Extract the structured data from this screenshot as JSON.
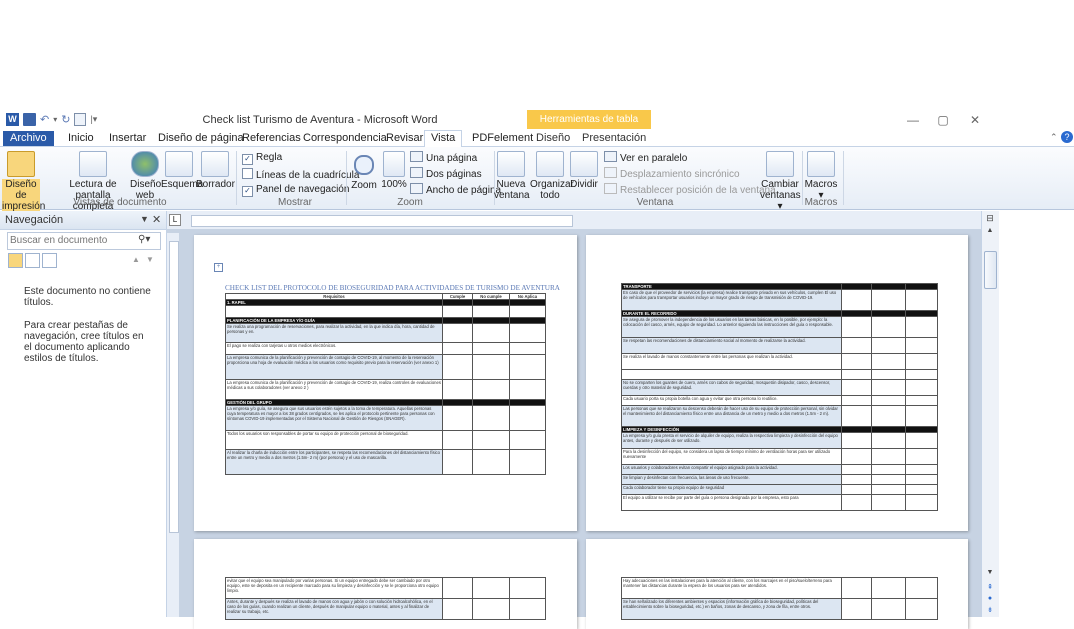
{
  "window": {
    "title": "Check list Turismo de Aventura - Microsoft Word",
    "context_tab_header": "Herramientas de tabla"
  },
  "tabs": [
    "Archivo",
    "Inicio",
    "Insertar",
    "Diseño de página",
    "Referencias",
    "Correspondencia",
    "Revisar",
    "Vista",
    "PDFelement",
    "Diseño",
    "Presentación"
  ],
  "active_tab": "Vista",
  "ribbon": {
    "doc_views": {
      "group": "Vistas de documento",
      "print_layout": [
        "Diseño de",
        "impresión"
      ],
      "full_screen": [
        "Lectura de",
        "pantalla completa"
      ],
      "web": [
        "Diseño",
        "web"
      ],
      "outline": "Esquema",
      "draft": "Borrador"
    },
    "show": {
      "group": "Mostrar",
      "ruler": "Regla",
      "gridlines": "Líneas de la cuadrícula",
      "nav_pane": "Panel de navegación"
    },
    "zoom": {
      "group": "Zoom",
      "zoom": "Zoom",
      "hundred": "100%",
      "one_page": "Una página",
      "two_pages": "Dos páginas",
      "page_width": "Ancho de página"
    },
    "window": {
      "group": "Ventana",
      "new_window": [
        "Nueva",
        "ventana"
      ],
      "arrange_all": [
        "Organizar",
        "todo"
      ],
      "split": "Dividir",
      "side_by_side": "Ver en paralelo",
      "sync_scroll": "Desplazamiento sincrónico",
      "reset_position": "Restablecer posición de la ventana",
      "switch_windows": [
        "Cambiar",
        "ventanas ▾"
      ]
    },
    "macros": {
      "group": "Macros",
      "macros": "Macros"
    }
  },
  "nav_pane": {
    "title": "Navegación",
    "search_placeholder": "Buscar en documento",
    "empty_line1": "Este documento no contiene títulos.",
    "empty_line2": "Para crear pestañas de navegación, cree títulos en el documento aplicando estilos de títulos."
  },
  "document": {
    "page1": {
      "title": "CHECK LIST DEL PROTOCOLO DE BIOSEGURIDAD PARA ACTIVIDADES DE TURISMO DE AVENTURA",
      "headers": [
        "Requisitos",
        "Cumple",
        "No cumple",
        "No Aplica"
      ],
      "rows": [
        {
          "type": "sec",
          "text": "1.   RAPEL"
        },
        {
          "type": "blank",
          "text": ""
        },
        {
          "type": "sec",
          "text": "PLANIFICACIÓN DE LA EMPRESA Y/O GUÍA"
        },
        {
          "type": "blue",
          "text": "Se realiza una programación de reservaciones, para realizar la actividad, en la que indica día, hora, cantidad de personas y en."
        },
        {
          "type": "row",
          "text": "El pago se realiza con tarjetas u otros medios electrónicos."
        },
        {
          "type": "blue",
          "text": "La empresa comunica de la planificación y prevención de contagio de COVID-19, al momento de la reservación proporciona una hoja de evaluación médica a los usuarios como requisito previo para la reservación (ver anexo 1)"
        },
        {
          "type": "row",
          "text": "La empresa comunica de la planificación y prevención de contagio de COVID-19, realiza controles de evaluaciones médicas a sus colaboradores (ver anexo 2 )"
        },
        {
          "type": "sec",
          "text": "GESTIÓN DEL GRUPO"
        },
        {
          "type": "blue",
          "text": "La empresa y/o guía, se asegura que sus usuarios estén sujetos a la toma de temperatura. Aquellas personas cuya temperatura es mayor a los 38 grados centígrados, se les aplica el protocolo pertinente para personas con síntomas COVID-19 implementadas por el Sistema Nacional de Gestión de Riesgos (SNAGER)."
        },
        {
          "type": "row",
          "text": "Todos los usuarios son responsables de portar su equipo de protección personal de bioseguridad."
        },
        {
          "type": "blue",
          "text": "Al realizar la charla de inducción entre los participantes, se respeta las recomendaciones del distanciamiento físico entre un metro y medio a dos metros (1.5m- 2 m) (por persona) y el uso de mascarilla."
        }
      ]
    },
    "page2": {
      "rows": [
        {
          "type": "sec",
          "text": "TRANSPORTE"
        },
        {
          "type": "blue",
          "text": "En caso de que el proveedor de servicios (la empresa) realice transporte privado en sus vehículos, cumplen El uso de vehículos para transportar usuarios incluye un mayor grado de riesgo de transmisión de COVID-19."
        },
        {
          "type": "sec",
          "text": "DURANTE EL RECORRIDO"
        },
        {
          "type": "blue",
          "text": "Se asegura de promover la independencia de los usuarios en las tareas básicas, en lo posible, por ejemplo: la colocación del casco, arnés, equipo de seguridad. Lo anterior siguiendo las instrucciones del guía o responsable."
        },
        {
          "type": "blue",
          "text": "Se respetan las recomendaciones de distanciamiento social al momento de realizarse la actividad."
        },
        {
          "type": "row",
          "text": "Se realiza el lavado de manos constantemente entre las personas que realizan la actividad."
        },
        {
          "type": "row",
          "text": ""
        },
        {
          "type": "blue",
          "text": "No se comparten los guantes de cuero, arnés con cabos de seguridad, mosquetón disipador, casco, descensor, cuerdas y otro material de seguridad."
        },
        {
          "type": "row",
          "text": "Cada usuario porta su propia botella con agua y evitar que otra persona lo reutilice."
        },
        {
          "type": "blue",
          "text": "Las personas que se realizaron su descenso deberán de hacer uso de su equipo de protección personal, sin olvidar el mantenimiento del distanciamiento físico entre una distancia de un metro y medio a dos metros (1.5m - 2 m)."
        },
        {
          "type": "sec",
          "text": "LIMPIEZA Y DESINFECCIÓN"
        },
        {
          "type": "blue",
          "text": "La empresa y/o guía presta el servicio de alquiler de equipo, realiza la respectiva limpieza y desinfección del equipo antes, durante y después de ser utilizado."
        },
        {
          "type": "row",
          "text": "Para la desinfección del equipo, se considera un lapso de tiempo mínimo de ventilación horas para ser utilizado nuevamente"
        },
        {
          "type": "blue",
          "text": "Los usuarios y colaboradores evitan compartir el equipo asignado para la actividad."
        },
        {
          "type": "blue",
          "text": "Se limpian y desinfectan con frecuencia, las áreas de uso frecuente."
        },
        {
          "type": "blue",
          "text": "Cada colaborador tiene su propio equipo de seguridad"
        },
        {
          "type": "row",
          "text": "El equipo a utilizar se recibe por parte del guía o persona designada por la empresa, esto para"
        }
      ]
    },
    "page3": {
      "rows": [
        {
          "type": "row",
          "text": "evitar que el equipo sea manipulado por varias personas. Si un equipo entregado debe ser cambiado por otro equipo, este se deposita en un recipiente marcado para su limpieza y desinfección y se le proporciona otro equipo limpio."
        },
        {
          "type": "blue",
          "text": "Antes, durante y después se realiza el lavado de manos con agua y jabón o con solución hidroalcohólica, en el caso de los guías, cuando realizan un cliente, después de manipular equipo o material, antes y al finalizar de realizar su trabajo, etc."
        }
      ]
    },
    "page4": {
      "rows": [
        {
          "type": "row",
          "text": "Hay adecuaciones en las instalaciones para la atención al cliente, con los marcajes en el piso/suelo/terreno para mantener las distancias durante la espera de los usuarios para ser atendidos."
        },
        {
          "type": "blue",
          "text": "Se han señalizado los diferentes ambientes y espacios (información gráfica de bioseguridad, políticas del establecimiento sobre la bioseguridad, etc.) en baños, zonas de descanso, y zona de fila, entre otros."
        }
      ]
    }
  }
}
